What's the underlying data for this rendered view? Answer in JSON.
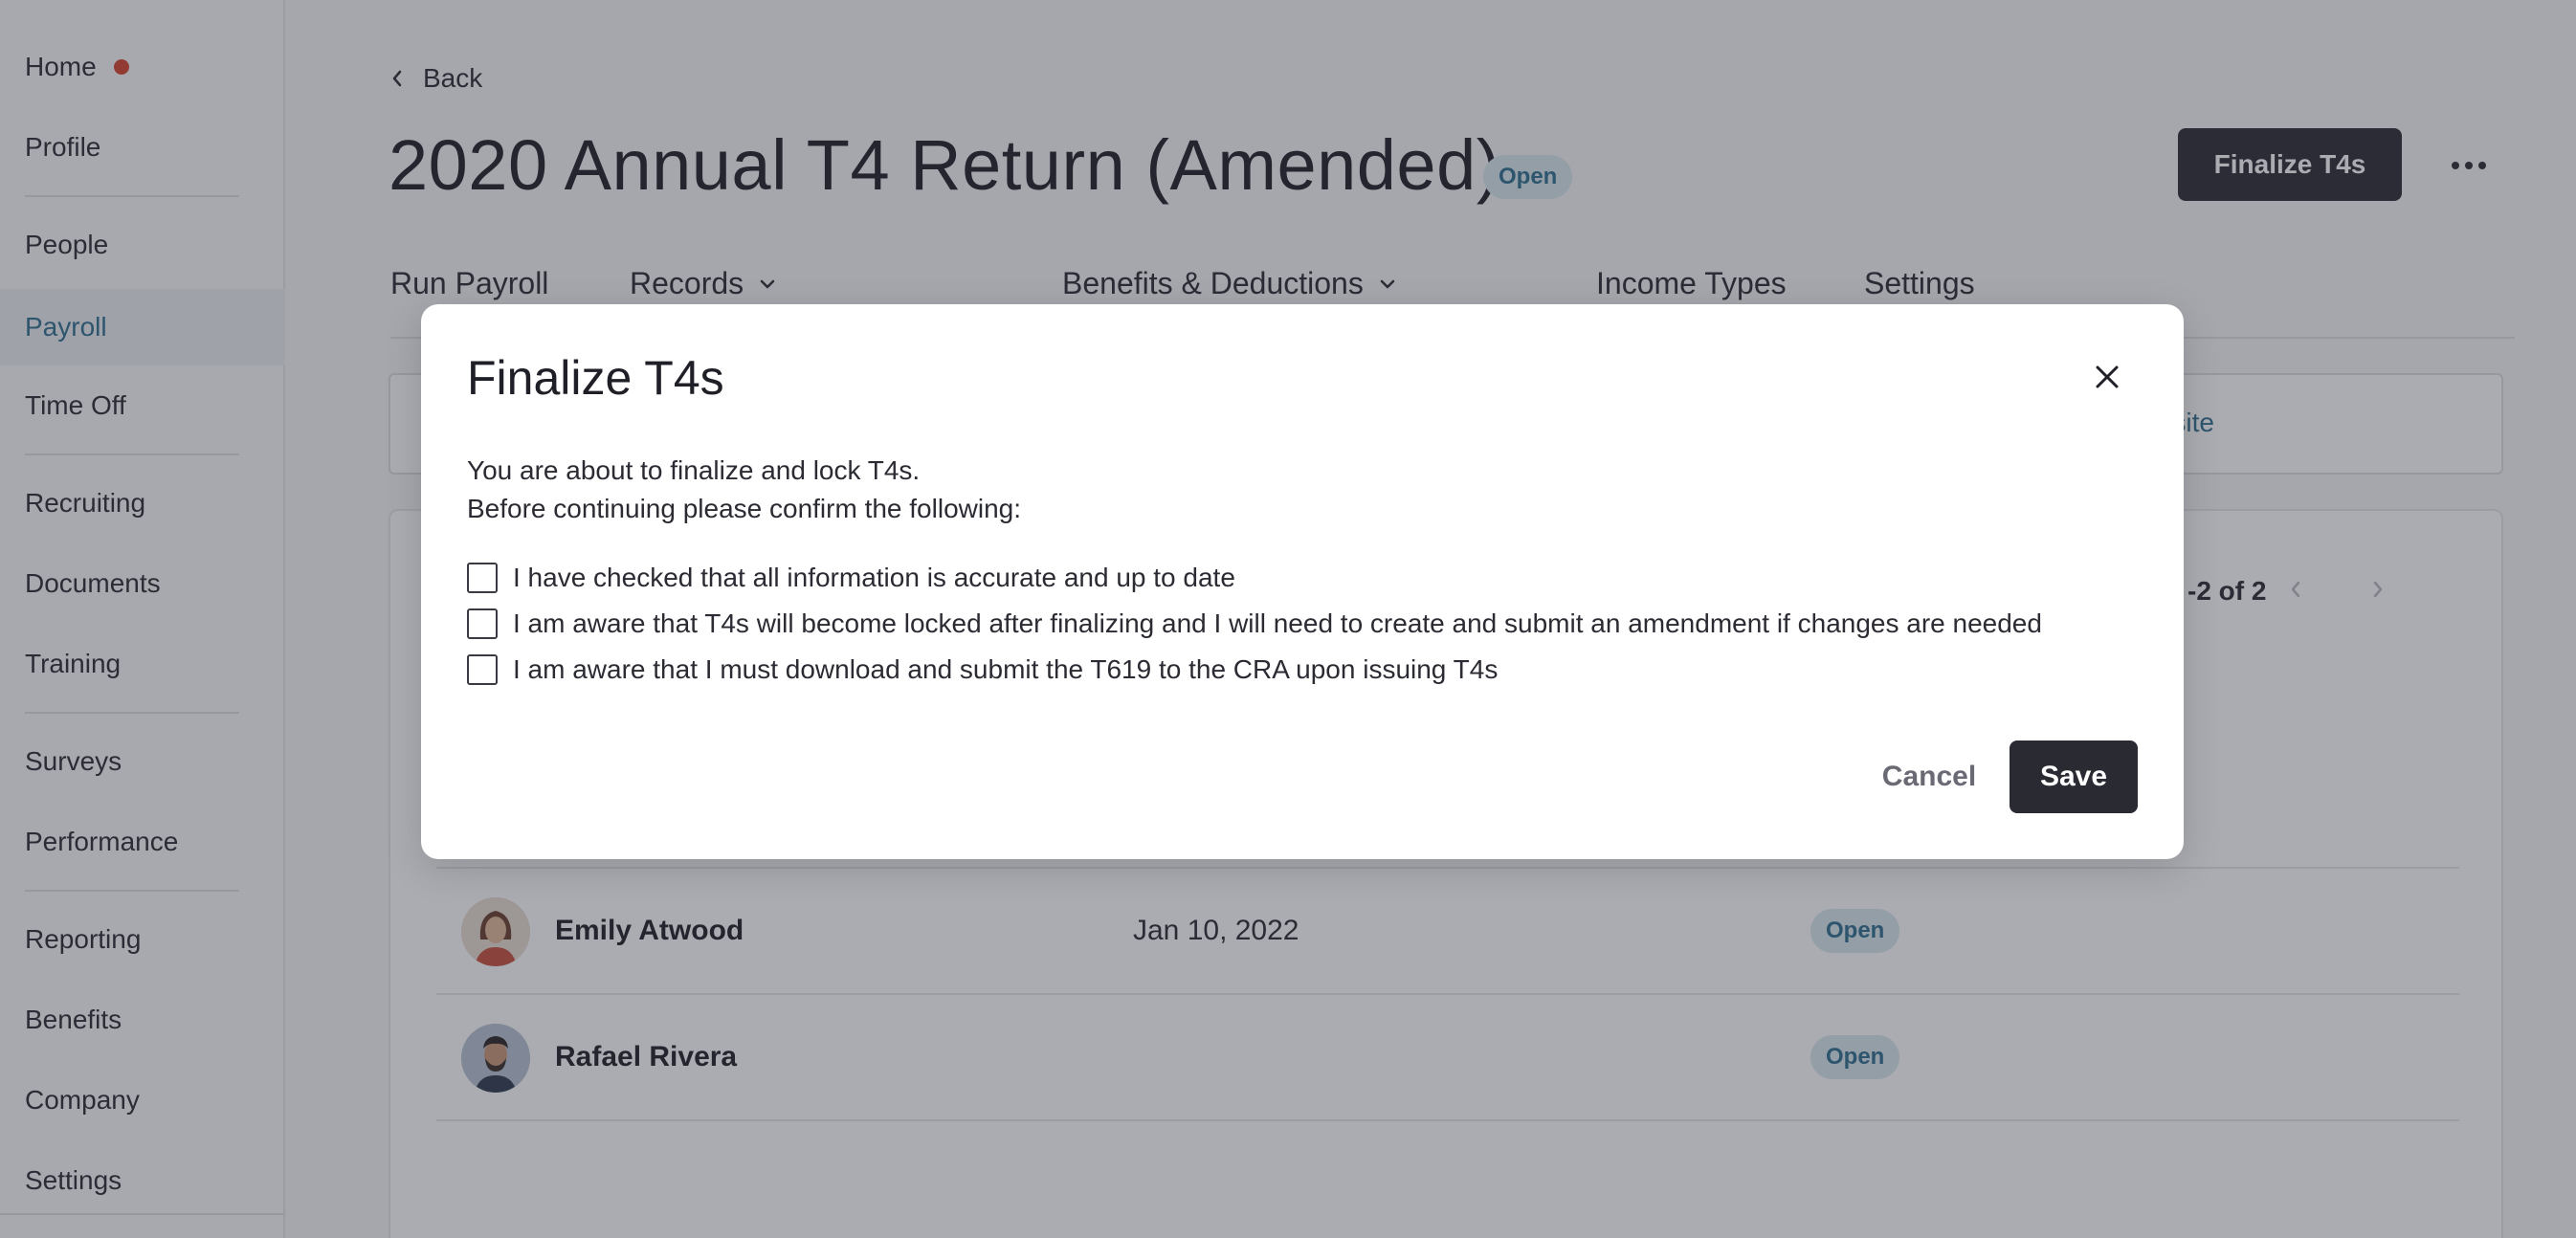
{
  "sidebar": {
    "items": [
      {
        "label": "Home"
      },
      {
        "label": "Profile"
      },
      {
        "label": "People"
      },
      {
        "label": "Payroll"
      },
      {
        "label": "Time Off"
      },
      {
        "label": "Recruiting"
      },
      {
        "label": "Documents"
      },
      {
        "label": "Training"
      },
      {
        "label": "Surveys"
      },
      {
        "label": "Performance"
      },
      {
        "label": "Reporting"
      },
      {
        "label": "Benefits"
      },
      {
        "label": "Company"
      },
      {
        "label": "Settings"
      }
    ],
    "active_item": "Payroll",
    "notification_color": "#d6442e"
  },
  "header": {
    "back_label": "Back",
    "title": "2020 Annual T4 Return (Amended)",
    "status_badge": "Open",
    "finalize_button": "Finalize T4s",
    "more_icon": "ellipsis-icon"
  },
  "tabs": [
    {
      "label": "Run Payroll"
    },
    {
      "label": "Records"
    },
    {
      "label": "Benefits & Deductions"
    },
    {
      "label": "Income Types"
    },
    {
      "label": "Settings"
    }
  ],
  "notice": {
    "link_fragment": "ebsite"
  },
  "list": {
    "pagination_fragment": "-2 of 2",
    "rows": [
      {
        "name": "Emily Atwood",
        "date": "Jan 10, 2022",
        "status": "Open"
      },
      {
        "name": "Rafael Rivera",
        "date": "",
        "status": "Open"
      }
    ]
  },
  "modal": {
    "title": "Finalize T4s",
    "intro_line1": "You are about to finalize and lock T4s.",
    "intro_line2": "Before continuing please confirm the following:",
    "checkboxes": [
      {
        "label": "I have checked that all information is accurate and up to date",
        "checked": false
      },
      {
        "label": "I am aware that T4s will become locked after finalizing and I will need to create and submit an amendment if changes are needed",
        "checked": false
      },
      {
        "label": "I am aware that I must download and submit the T619 to the CRA upon issuing T4s",
        "checked": false
      }
    ],
    "cancel_label": "Cancel",
    "save_label": "Save"
  },
  "colors": {
    "primary_dark": "#2a2a33",
    "accent_teal": "#2f6f8f",
    "badge_bg": "#d8e8ee"
  }
}
